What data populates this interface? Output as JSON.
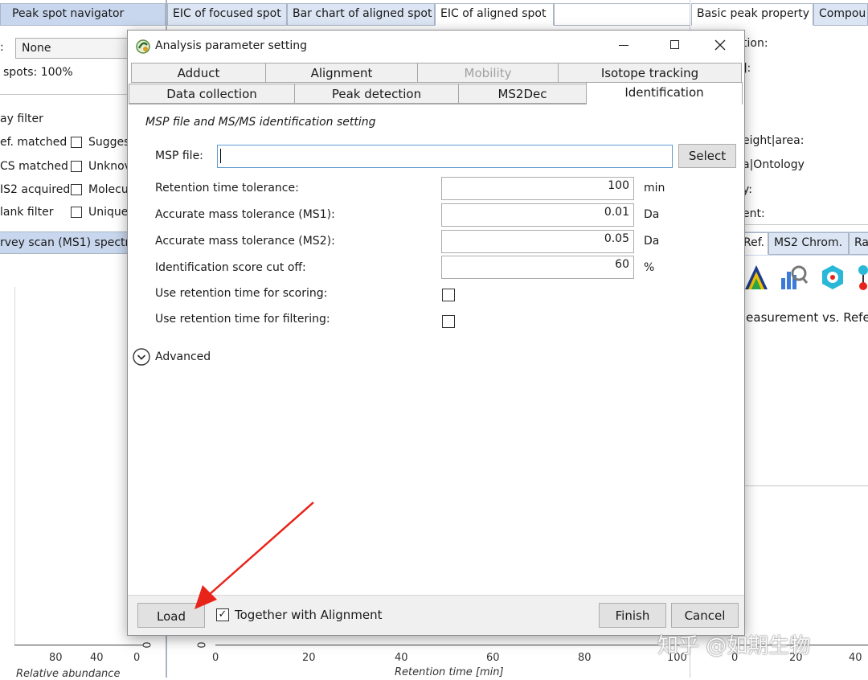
{
  "top_tabs": [
    "Peak spot navigator",
    "EIC of focused spot",
    "Bar chart of aligned spot",
    "EIC of aligned spot",
    "Basic peak property",
    "Compou"
  ],
  "left_panel": {
    "label_prefix": ":",
    "combo_value": "None",
    "spots_text": "spots: 100%",
    "display_filter": "ay filter",
    "filters": [
      {
        "label": "ef. matched",
        "right": "Sugges"
      },
      {
        "label": "CS matched",
        "right": "Unknov"
      },
      {
        "label": "IS2 acquired",
        "right": "Molecu"
      },
      {
        "label": "lank filter",
        "right": "Unique"
      }
    ],
    "survey_header": "rvey scan (MS1) spectr",
    "x_ticks": [
      "80",
      "40",
      "0"
    ],
    "y_tick": "0",
    "xlabel": "Relative abundance"
  },
  "center_chart": {
    "y_tick": "0",
    "x_ticks": [
      "0",
      "20",
      "40",
      "60",
      "80",
      "100"
    ],
    "xlabel": "Retention time [min]"
  },
  "right_panel": {
    "labels": [
      "tion:",
      "]:",
      "eight|area:",
      "a|Ontology",
      "y:",
      "ent:"
    ],
    "tabs": [
      "Ref.",
      "MS2 Chrom.",
      "Ra"
    ],
    "measurement_text": "leasurement vs. Refe",
    "x_ticks": [
      "0",
      "20",
      "40"
    ]
  },
  "dialog": {
    "title": "Analysis parameter setting",
    "tabs_row1": [
      "Adduct",
      "Alignment",
      "Mobility",
      "Isotope tracking"
    ],
    "tabs_row2": [
      "Data collection",
      "Peak detection",
      "MS2Dec",
      "Identification"
    ],
    "section_title": "MSP file and MS/MS identification setting",
    "msp_label": "MSP file:",
    "msp_value": "",
    "select_label": "Select",
    "params": [
      {
        "label": "Retention time tolerance:",
        "value": "100",
        "unit": "min"
      },
      {
        "label": "Accurate mass tolerance (MS1):",
        "value": "0.01",
        "unit": "Da"
      },
      {
        "label": "Accurate mass tolerance (MS2):",
        "value": "0.05",
        "unit": "Da"
      },
      {
        "label": "Identification score cut off:",
        "value": "60",
        "unit": "%"
      }
    ],
    "checks": [
      {
        "label": "Use retention time for scoring:",
        "checked": false
      },
      {
        "label": "Use retention time for filtering:",
        "checked": false
      }
    ],
    "advanced_label": "Advanced",
    "load_label": "Load",
    "together_label": "Together with Alignment",
    "together_checked": true,
    "finish_label": "Finish",
    "cancel_label": "Cancel"
  },
  "watermark": "知乎 @如期生物",
  "colors": {
    "tab_blue": "#dbe5f3",
    "header_blue": "#c9d7ee",
    "arrow_red": "#e8231a"
  }
}
